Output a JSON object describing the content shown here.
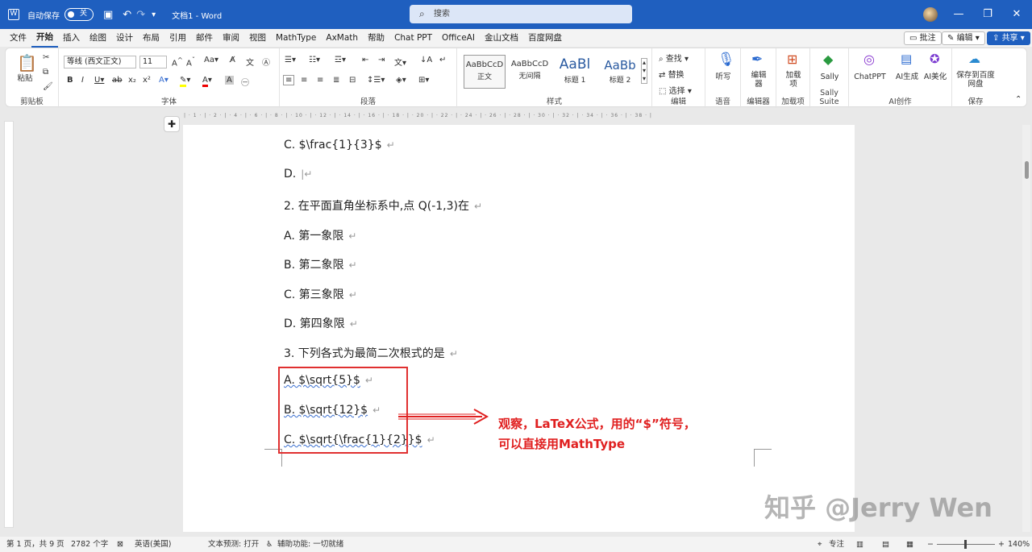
{
  "titlebar": {
    "autosave_label": "自动保存",
    "autosave_state": "关",
    "doc_title": "文档1 - Word",
    "search_placeholder": "搜索"
  },
  "menu": {
    "tabs": [
      "文件",
      "开始",
      "插入",
      "绘图",
      "设计",
      "布局",
      "引用",
      "邮件",
      "审阅",
      "视图",
      "MathType",
      "AxMath",
      "帮助",
      "Chat PPT",
      "OfficeAI",
      "金山文档",
      "百度网盘"
    ],
    "active": "开始",
    "comment_btn": "批注",
    "edit_btn": "编辑",
    "share_btn": "共享"
  },
  "ribbon": {
    "clipboard": {
      "paste": "粘贴",
      "label": "剪贴板"
    },
    "font": {
      "name": "等线 (西文正文)",
      "size": "11",
      "label": "字体"
    },
    "paragraph": {
      "label": "段落"
    },
    "styles": {
      "items": [
        {
          "preview": "AaBbCcD",
          "name": "正文"
        },
        {
          "preview": "AaBbCcD",
          "name": "无间隔"
        },
        {
          "preview": "AaBl",
          "name": "标题 1"
        },
        {
          "preview": "AaBb",
          "name": "标题 2"
        }
      ],
      "label": "样式"
    },
    "editing": {
      "find": "查找",
      "replace": "替换",
      "select": "选择",
      "label": "编辑"
    },
    "voice": {
      "dictate": "听写",
      "label": "语音"
    },
    "editor": {
      "btn": "编辑器",
      "label": "编辑器"
    },
    "addins": {
      "btn": "加载项",
      "label": "加载项"
    },
    "sally": {
      "btn": "Sally",
      "label": "Sally Suite"
    },
    "ai": {
      "chatppt": "ChatPPT",
      "gen": "AI生成",
      "beautify": "AI美化",
      "label": "AI创作"
    },
    "save": {
      "btn": "保存到百度网盘",
      "label": "保存"
    }
  },
  "document": {
    "lines": [
      {
        "text": "C. $\\frac{1}{3}$"
      },
      {
        "text": "D."
      },
      {
        "text": "2.  在平面直角坐标系中,点  Q(-1,3)在"
      },
      {
        "text": "A.  第一象限"
      },
      {
        "text": "B.  第二象限"
      },
      {
        "text": "C.  第三象限"
      },
      {
        "text": "D.  第四象限"
      },
      {
        "text": "3.  下列各式为最简二次根式的是"
      },
      {
        "text": "A. $\\sqrt{5}$"
      },
      {
        "text": "B. $\\sqrt{12}$"
      },
      {
        "text": "C. $\\sqrt{\\frac{1}{2}}$"
      }
    ],
    "annotation_line1": "观察，LaTeX公式，用的“$”符号，",
    "annotation_line2": "可以直接用MathType",
    "watermark": "知乎 @Jerry Wen"
  },
  "statusbar": {
    "page": "第 1 页，共 9 页",
    "words": "2782 个字",
    "lang": "英语(美国)",
    "predict": "文本预测: 打开",
    "accessibility": "辅助功能: 一切就绪",
    "focus": "专注",
    "zoom": "140%"
  }
}
